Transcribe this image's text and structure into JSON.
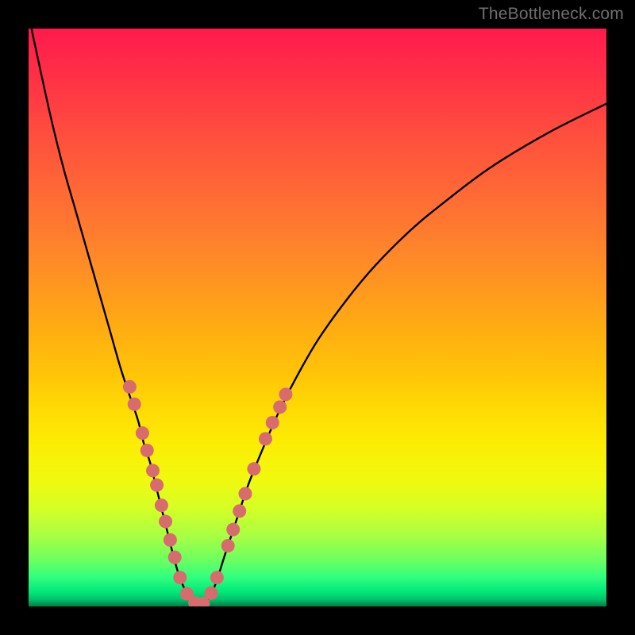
{
  "watermark": "TheBottleneck.com",
  "colors": {
    "background": "#000000",
    "curve_stroke": "#000000",
    "marker_fill": "#d86b6e",
    "gradient_top": "#ff1a4d",
    "gradient_bottom": "#007f46"
  },
  "chart_data": {
    "type": "line",
    "title": "",
    "xlabel": "",
    "ylabel": "",
    "xlim": [
      0,
      100
    ],
    "ylim": [
      0,
      100
    ],
    "grid": false,
    "legend": false,
    "series": [
      {
        "name": "curve",
        "x": [
          0.5,
          2,
          4,
          6,
          8,
          10,
          12,
          14,
          16,
          18,
          19,
          20,
          21,
          22,
          23,
          24,
          25,
          26,
          27,
          28,
          29,
          30,
          32,
          34,
          36,
          38,
          40,
          43,
          46,
          50,
          55,
          60,
          66,
          72,
          80,
          90,
          100
        ],
        "y": [
          100,
          93,
          84,
          76,
          69,
          62,
          55,
          48,
          41,
          35,
          32,
          28,
          25,
          21,
          17,
          13,
          9,
          5.5,
          3,
          1.2,
          0.3,
          0,
          3,
          9,
          15,
          21,
          26,
          33,
          39,
          46,
          53,
          59,
          65,
          70,
          76,
          82,
          87
        ]
      }
    ],
    "markers": [
      {
        "x": 17.5,
        "y": 38
      },
      {
        "x": 18.3,
        "y": 35
      },
      {
        "x": 19.7,
        "y": 30
      },
      {
        "x": 20.5,
        "y": 27
      },
      {
        "x": 21.5,
        "y": 23.5
      },
      {
        "x": 22.2,
        "y": 21
      },
      {
        "x": 23.0,
        "y": 17.5
      },
      {
        "x": 23.7,
        "y": 14.7
      },
      {
        "x": 24.5,
        "y": 11.5
      },
      {
        "x": 25.3,
        "y": 8.5
      },
      {
        "x": 26.2,
        "y": 5.0
      },
      {
        "x": 27.4,
        "y": 2.2
      },
      {
        "x": 28.8,
        "y": 0.6
      },
      {
        "x": 30.2,
        "y": 0.5
      },
      {
        "x": 31.6,
        "y": 2.3
      },
      {
        "x": 32.6,
        "y": 5.0
      },
      {
        "x": 34.5,
        "y": 10.5
      },
      {
        "x": 35.4,
        "y": 13.3
      },
      {
        "x": 36.5,
        "y": 16.5
      },
      {
        "x": 37.5,
        "y": 19.5
      },
      {
        "x": 39.0,
        "y": 23.8
      },
      {
        "x": 41.0,
        "y": 29.0
      },
      {
        "x": 42.2,
        "y": 31.8
      },
      {
        "x": 43.5,
        "y": 34.5
      },
      {
        "x": 44.5,
        "y": 36.7
      }
    ]
  }
}
